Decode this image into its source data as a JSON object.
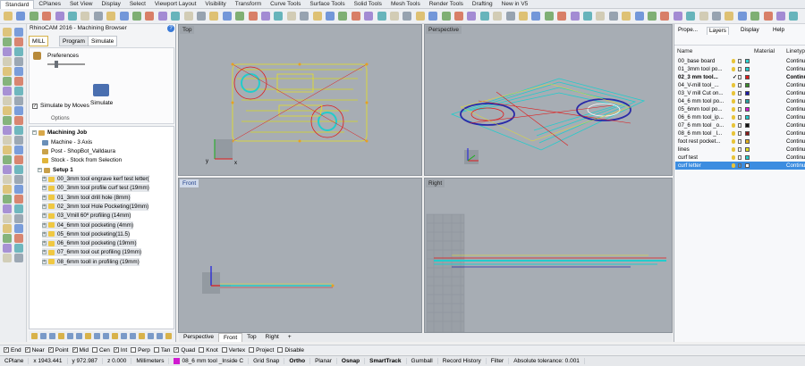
{
  "toolbar_tabs": [
    "Standard",
    "CPlanes",
    "Set View",
    "Display",
    "Select",
    "Viewport Layout",
    "Visibility",
    "Transform",
    "Curve Tools",
    "Surface Tools",
    "Solid Tools",
    "Mesh Tools",
    "Render Tools",
    "Drafting",
    "New in V5"
  ],
  "rhinocam": {
    "title": "RhinoCAM 2016 - Machining Browser",
    "help": "?",
    "tabs": [
      "MILL",
      "Program",
      "Simulate"
    ],
    "preferences": "Preferences",
    "simulate_by_moves": "Simulate by Moves",
    "simulate": "Simulate",
    "options": "Options",
    "tree": {
      "job": "Machining Job",
      "machine": "Machine - 3 Axis",
      "post": "Post - ShopBot_Valldaura",
      "stock": "Stock - Stock from Selection",
      "setup": "Setup 1",
      "operations": [
        "00_3mm tool engrave kerf test letter(",
        "00_3mm tool profile curf test (19mm)",
        "01_3mm tool drill hole (8mm)",
        "02_3mm tool Hole Pocketing(19mm)",
        "03_Vmill 60º profiling (14mm)",
        "04_6mm tool pocketing (4mm)",
        "05_6mm tool pocketing(11.5)",
        "06_6mm tool pocketing (19mm)",
        "07_6mm tool out profiling (19mm)",
        "08_6mm tooll in profiling (19mm)"
      ]
    }
  },
  "viewports": {
    "top": "Top",
    "perspective": "Perspective",
    "front": "Front",
    "right": "Right",
    "axis_x": "x",
    "axis_y": "y",
    "axis_z": "z"
  },
  "viewport_tabs": [
    "Perspective",
    "Front",
    "Top",
    "Right"
  ],
  "viewport_tab_add": "+",
  "layers_panel": {
    "tabs": [
      "Prope...",
      "Layers",
      "Display",
      "Help"
    ],
    "columns": [
      "Name",
      "Material",
      "Linetyp"
    ],
    "layers": [
      {
        "name": "00_base board",
        "color": "#2fd4d4",
        "linetype": "Continu",
        "current": false,
        "selected": false
      },
      {
        "name": "01_3mm tool po...",
        "color": "#22cccc",
        "linetype": "Continu",
        "current": false,
        "selected": false
      },
      {
        "name": "02_3 mm tool...",
        "color": "#e01a1a",
        "linetype": "Continu",
        "current": true,
        "selected": false
      },
      {
        "name": "04_V-mill tool_...",
        "color": "#3a8a2a",
        "linetype": "Continu",
        "current": false,
        "selected": false
      },
      {
        "name": "03_V mill Cut on...",
        "color": "#1a1aa8",
        "linetype": "Continu",
        "current": false,
        "selected": false
      },
      {
        "name": "04_6 mm tool po...",
        "color": "#2aa0a0",
        "linetype": "Continu",
        "current": false,
        "selected": false
      },
      {
        "name": "05_6mm tool po...",
        "color": "#d01ad0",
        "linetype": "Continu",
        "current": false,
        "selected": false
      },
      {
        "name": "06_6 mm tool_ip...",
        "color": "#22cccc",
        "linetype": "Continu",
        "current": false,
        "selected": false
      },
      {
        "name": "07_6 mm tool _o...",
        "color": "#111111",
        "linetype": "Continu",
        "current": false,
        "selected": false
      },
      {
        "name": "08_6 mm tool _l...",
        "color": "#8a1a1a",
        "linetype": "Continu",
        "current": false,
        "selected": false
      },
      {
        "name": "foot rest pocket...",
        "color": "#e0b020",
        "linetype": "Continu",
        "current": false,
        "selected": false
      },
      {
        "name": "lines",
        "color": "#e0e020",
        "linetype": "Continu",
        "current": false,
        "selected": false
      },
      {
        "name": "curf test",
        "color": "#22cccc",
        "linetype": "Continu",
        "current": false,
        "selected": false
      },
      {
        "name": "curf letter",
        "color": "#ffffff",
        "linetype": "Continu",
        "current": false,
        "selected": true
      }
    ]
  },
  "osnaps": [
    {
      "label": "End",
      "on": true
    },
    {
      "label": "Near",
      "on": true
    },
    {
      "label": "Point",
      "on": true
    },
    {
      "label": "Mid",
      "on": true
    },
    {
      "label": "Cen",
      "on": false
    },
    {
      "label": "Int",
      "on": true
    },
    {
      "label": "Perp",
      "on": false
    },
    {
      "label": "Tan",
      "on": false
    },
    {
      "label": "Quad",
      "on": true
    },
    {
      "label": "Knot",
      "on": false
    },
    {
      "label": "Vertex",
      "on": false
    },
    {
      "label": "Project",
      "on": false
    },
    {
      "label": "Disable",
      "on": false
    }
  ],
  "status": {
    "cplane": "CPlane",
    "x": "x 1943.441",
    "y": "y 972.987",
    "z": "z 0.000",
    "units": "Millimeters",
    "layer": "08_6 mm tool _Inside C",
    "layer_color": "#d01ad0",
    "items": [
      "Grid Snap",
      "Ortho",
      "Planar",
      "Osnap",
      "SmartTrack",
      "Gumball",
      "Record History",
      "Filter"
    ],
    "tolerance": "Absolute tolerance: 0.001"
  }
}
